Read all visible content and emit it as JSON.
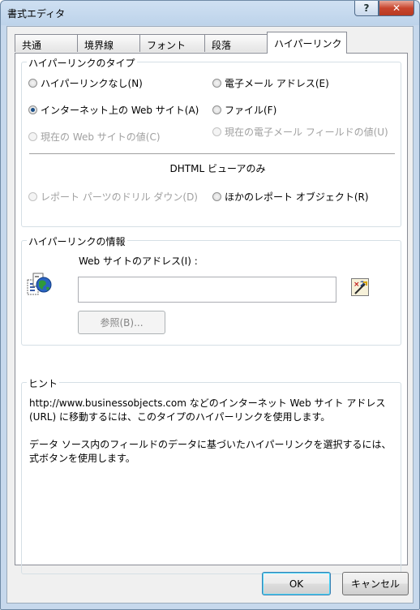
{
  "window": {
    "title": "書式エディタ",
    "help_label": "?",
    "close_label": "✕"
  },
  "tabs": [
    {
      "label": "共通"
    },
    {
      "label": "境界線"
    },
    {
      "label": "フォント"
    },
    {
      "label": "段落"
    },
    {
      "label": "ハイパーリンク"
    }
  ],
  "type_group": {
    "label": "ハイパーリンクのタイプ",
    "options": {
      "none": {
        "label": "ハイパーリンクなし(N)",
        "checked": false,
        "enabled": true
      },
      "email": {
        "label": "電子メール アドレス(E)",
        "checked": false,
        "enabled": true
      },
      "website": {
        "label": "インターネット上の Web サイト(A)",
        "checked": true,
        "enabled": true
      },
      "file": {
        "label": "ファイル(F)",
        "checked": false,
        "enabled": true
      },
      "current_site": {
        "label": "現在の Web サイトの値(C)",
        "checked": false,
        "enabled": false
      },
      "current_email": {
        "label": "現在の電子メール フィールドの値(U)",
        "checked": false,
        "enabled": false
      },
      "drilldown": {
        "label": "レポート パーツのドリル ダウン(D)",
        "checked": false,
        "enabled": false
      },
      "other_report": {
        "label": "ほかのレポート オブジェクト(R)",
        "checked": false,
        "enabled": true
      }
    },
    "dhtml_caption": "DHTML ビューアのみ"
  },
  "info_group": {
    "label": "ハイパーリンクの情報",
    "address_label": "Web サイトのアドレス(I) :",
    "address_value": "",
    "browse_label": "参照(B)..."
  },
  "hint_group": {
    "label": "ヒント",
    "text1": "http://www.businessobjects.com などのインターネット Web サイト アドレス (URL) に移動するには、このタイプのハイパーリンクを使用します。",
    "text2": "データ ソース内のフィールドのデータに基づいたハイパーリンクを選択するには、式ボタンを使用します。"
  },
  "footer": {
    "ok_label": "OK",
    "cancel_label": "キャンセル"
  },
  "colors": {
    "title_bar": "#c6d8ec",
    "close_button": "#c8452e",
    "selected_radio": "#1a4f87",
    "default_button_border": "#3c7fb1"
  },
  "icons": {
    "hyperlink": "hyperlink-globe-icon",
    "formula": "formula-icon"
  }
}
